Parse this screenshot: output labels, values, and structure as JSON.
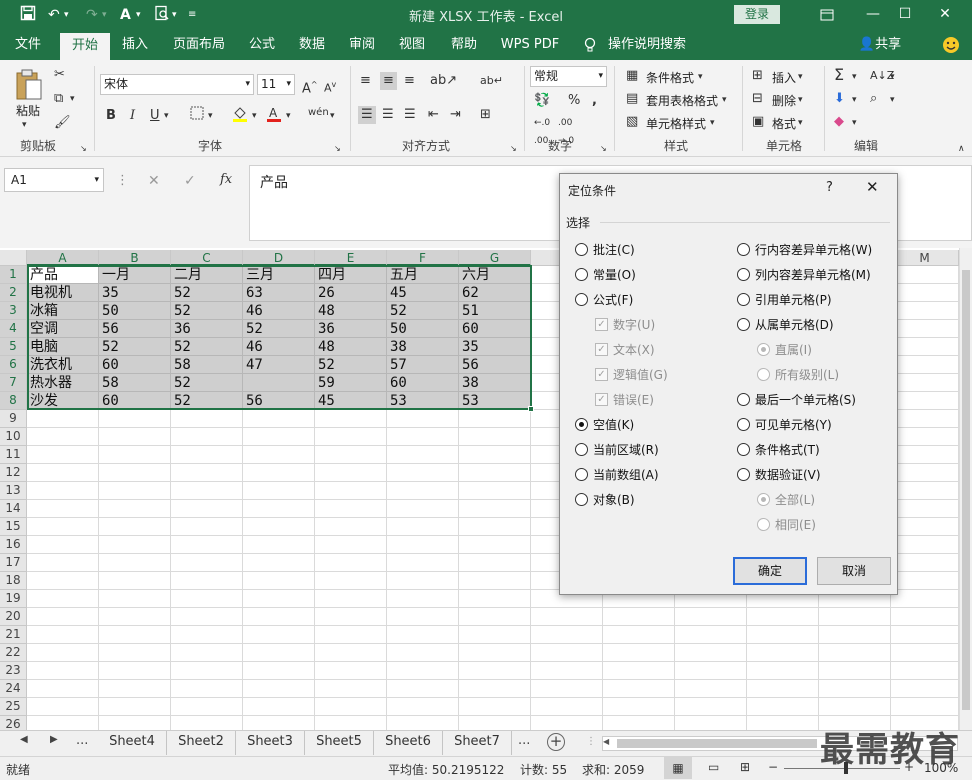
{
  "window": {
    "title": "新建 XLSX 工作表 - Excel",
    "login_label": "登录"
  },
  "tabs": [
    "文件",
    "开始",
    "插入",
    "页面布局",
    "公式",
    "数据",
    "审阅",
    "视图",
    "帮助",
    "WPS PDF"
  ],
  "tab_search": "操作说明搜索",
  "share_label": "共享",
  "ribbon": {
    "clipboard": {
      "paste": "粘贴",
      "group": "剪贴板"
    },
    "font": {
      "name": "宋体",
      "size": "11",
      "group": "字体",
      "bold": "B",
      "italic": "I",
      "underline": "U"
    },
    "alignment": {
      "group": "对齐方式"
    },
    "number": {
      "format": "常规",
      "group": "数字",
      "percent": "%"
    },
    "styles": {
      "conditional": "条件格式",
      "table": "套用表格格式",
      "cell": "单元格样式",
      "group": "样式"
    },
    "cells": {
      "insert": "插入",
      "delete": "删除",
      "format": "格式",
      "group": "单元格"
    },
    "editing": {
      "group": "编辑"
    }
  },
  "formula_bar": {
    "name_box": "A1",
    "content": "产品",
    "fx": "fx"
  },
  "columns": [
    "A",
    "B",
    "C",
    "D",
    "E",
    "F",
    "G"
  ],
  "extra_col": "M",
  "rows": [
    [
      "产品",
      "一月",
      "二月",
      "三月",
      "四月",
      "五月",
      "六月"
    ],
    [
      "电视机",
      "35",
      "52",
      "63",
      "26",
      "45",
      "62"
    ],
    [
      "冰箱",
      "50",
      "52",
      "46",
      "48",
      "52",
      "51"
    ],
    [
      "空调",
      "56",
      "36",
      "52",
      "36",
      "50",
      "60"
    ],
    [
      "电脑",
      "52",
      "52",
      "46",
      "48",
      "38",
      "35"
    ],
    [
      "洗衣机",
      "60",
      "58",
      "47",
      "52",
      "57",
      "56"
    ],
    [
      "热水器",
      "58",
      "52",
      "",
      "59",
      "60",
      "38"
    ],
    [
      "沙发",
      "60",
      "52",
      "56",
      "45",
      "53",
      "53"
    ]
  ],
  "row_numbers": [
    "1",
    "2",
    "3",
    "4",
    "5",
    "6",
    "7",
    "8",
    "9",
    "10",
    "11",
    "12",
    "13",
    "14",
    "15",
    "16",
    "17",
    "18",
    "19",
    "20",
    "21",
    "22",
    "23",
    "24",
    "25",
    "26"
  ],
  "sheets": [
    "Sheet4",
    "Sheet2",
    "Sheet3",
    "Sheet5",
    "Sheet6",
    "Sheet7"
  ],
  "sheet_more": "...",
  "status": {
    "ready": "就绪",
    "average": "平均值: 50.2195122",
    "count": "计数: 55",
    "sum": "求和: 2059",
    "zoom": "100%"
  },
  "dialog": {
    "title": "定位条件",
    "help": "?",
    "section": "选择",
    "left": [
      {
        "label": "批注(C)",
        "type": "radio"
      },
      {
        "label": "常量(O)",
        "type": "radio"
      },
      {
        "label": "公式(F)",
        "type": "radio"
      },
      {
        "label": "数字(U)",
        "type": "check",
        "disabled": true
      },
      {
        "label": "文本(X)",
        "type": "check",
        "disabled": true
      },
      {
        "label": "逻辑值(G)",
        "type": "check",
        "disabled": true
      },
      {
        "label": "错误(E)",
        "type": "check",
        "disabled": true
      },
      {
        "label": "空值(K)",
        "type": "radio",
        "checked": true
      },
      {
        "label": "当前区域(R)",
        "type": "radio"
      },
      {
        "label": "当前数组(A)",
        "type": "radio"
      },
      {
        "label": "对象(B)",
        "type": "radio"
      }
    ],
    "right": [
      {
        "label": "行内容差异单元格(W)",
        "type": "radio"
      },
      {
        "label": "列内容差异单元格(M)",
        "type": "radio"
      },
      {
        "label": "引用单元格(P)",
        "type": "radio"
      },
      {
        "label": "从属单元格(D)",
        "type": "radio"
      },
      {
        "label": "直属(I)",
        "type": "radio",
        "disabled": true,
        "checked": true,
        "indent": true
      },
      {
        "label": "所有级别(L)",
        "type": "radio",
        "disabled": true,
        "indent": true
      },
      {
        "label": "最后一个单元格(S)",
        "type": "radio"
      },
      {
        "label": "可见单元格(Y)",
        "type": "radio"
      },
      {
        "label": "条件格式(T)",
        "type": "radio"
      },
      {
        "label": "数据验证(V)",
        "type": "radio"
      },
      {
        "label": "全部(L)",
        "type": "radio",
        "disabled": true,
        "checked": true,
        "indent": true
      },
      {
        "label": "相同(E)",
        "type": "radio",
        "disabled": true,
        "indent": true
      }
    ],
    "ok_label": "确定",
    "cancel_label": "取消"
  },
  "watermark": "最需教育",
  "colors": {
    "excel_green": "#217346",
    "selection_gray": "#cfcfcf"
  }
}
